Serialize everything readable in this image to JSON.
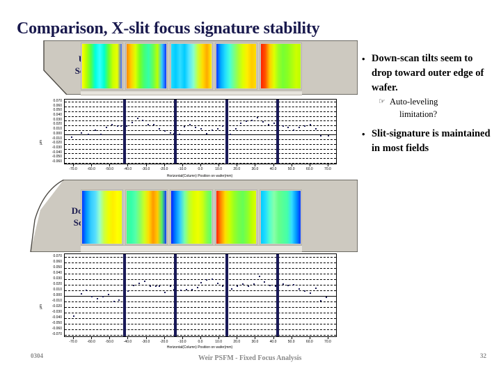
{
  "slide": {
    "title": "Comparison, X-slit focus signature stability",
    "title_color": "#19194d"
  },
  "wafer_up": {
    "label_line1": "Up",
    "label_line2": "Scan",
    "field_count": 5
  },
  "wafer_down": {
    "label_line1": "Down",
    "label_line2": "Scan",
    "field_count": 5
  },
  "bullets": {
    "item1": "Down-scan tilts seem to drop toward outer edge of wafer.",
    "sub1_icon": "pointing-hand-icon",
    "sub1_line1": "Auto-leveling",
    "sub1_line2": "limitation?",
    "item2": "Slit-signature is maintained in most fields",
    "bullet_glyph": "•"
  },
  "footer": {
    "date": "0304",
    "center": "Weir PSFM - Fixed Focus Analysis",
    "page": "32"
  },
  "chart_data": [
    {
      "id": "up-scan-chart",
      "type": "scatter",
      "title": "",
      "xlabel": "Horizontal(Column) Position on wafer(mm)",
      "ylabel": "µm",
      "xlim": [
        -75,
        75
      ],
      "ylim": [
        -0.065,
        0.075
      ],
      "grid": true,
      "legend": "none",
      "xticks": [
        -70.0,
        -60.0,
        -50.0,
        -40.0,
        -30.0,
        -20.0,
        -10.0,
        0.0,
        10.0,
        20.0,
        30.0,
        40.0,
        50.0,
        60.0,
        70.0
      ],
      "xtick_labels": [
        "-70.0",
        "-60.0",
        "-50.0",
        "-40.0",
        "-30.0",
        "-20.0",
        "-10.0",
        "0.0",
        "10.0",
        "20.0",
        "30.0",
        "40.0",
        "50.0",
        "60.0",
        "70.0"
      ],
      "yticks": [
        0.07,
        0.06,
        0.05,
        0.04,
        0.03,
        0.02,
        0.01,
        0.0,
        -0.01,
        -0.02,
        -0.03,
        -0.04,
        -0.05,
        -0.06
      ],
      "ytick_labels": [
        "0.070",
        "0.060",
        "0.050",
        "0.040",
        "0.030",
        "0.020",
        "0.010",
        "0.000",
        "-0.010",
        "-0.020",
        "-0.030",
        "-0.040",
        "-0.050",
        "-0.060"
      ],
      "field_boundaries": [
        -42.0,
        -14.0,
        14.0,
        42.0
      ],
      "x": [
        -71,
        -66,
        -62,
        -58,
        -55,
        -52,
        -49,
        -46,
        -44,
        -42,
        -41,
        -38,
        -35,
        -32,
        -29,
        -26,
        -23,
        -20,
        -17,
        -15,
        -14,
        -12,
        -9,
        -6,
        -3,
        0,
        3,
        6,
        9,
        12,
        14,
        16,
        19,
        22,
        25,
        28,
        31,
        34,
        37,
        40,
        42,
        45,
        48,
        51,
        54,
        57,
        60,
        63,
        66,
        70
      ],
      "y": [
        -0.006,
        0.004,
        0.0,
        0.009,
        0.0,
        0.016,
        0.021,
        0.019,
        0.018,
        -0.014,
        0.019,
        0.026,
        0.035,
        0.031,
        0.022,
        0.021,
        0.013,
        0.008,
        0.004,
        0.002,
        -0.005,
        0.001,
        0.017,
        0.021,
        0.016,
        0.013,
        0.002,
        0.009,
        0.013,
        0.018,
        -0.04,
        0.001,
        0.012,
        0.024,
        0.029,
        0.03,
        0.036,
        0.027,
        0.022,
        0.024,
        0.034,
        0.019,
        0.016,
        0.01,
        0.016,
        0.019,
        0.021,
        0.013,
        -0.003,
        -0.003
      ]
    },
    {
      "id": "down-scan-chart",
      "type": "scatter",
      "title": "",
      "xlabel": "Horizontal(Column) Position on wafer(mm)",
      "ylabel": "µm",
      "xlim": [
        -75,
        75
      ],
      "ylim": [
        -0.075,
        0.075
      ],
      "grid": true,
      "legend": "none",
      "xticks": [
        -70.0,
        -60.0,
        -50.0,
        -40.0,
        -30.0,
        -20.0,
        -10.0,
        0.0,
        10.0,
        20.0,
        30.0,
        40.0,
        50.0,
        60.0,
        70.0
      ],
      "xtick_labels": [
        "-70.0",
        "-60.0",
        "-50.0",
        "-40.0",
        "-30.0",
        "-20.0",
        "-10.0",
        "0.0",
        "10.0",
        "20.0",
        "30.0",
        "40.0",
        "50.0",
        "60.0",
        "70.0"
      ],
      "yticks": [
        0.07,
        0.06,
        0.05,
        0.04,
        0.03,
        0.02,
        0.01,
        0.0,
        -0.01,
        -0.02,
        -0.03,
        -0.04,
        -0.05,
        -0.06,
        -0.07
      ],
      "ytick_labels": [
        "0.070",
        "0.060",
        "0.050",
        "0.040",
        "0.030",
        "0.020",
        "0.010",
        "0.000",
        "-0.010",
        "-0.020",
        "-0.030",
        "-0.040",
        "-0.050",
        "-0.060",
        "-0.070"
      ],
      "field_boundaries": [
        -42.0,
        -14.0,
        14.0,
        42.0
      ],
      "x": [
        -70,
        -66,
        -63,
        -60,
        -57,
        -54,
        -51,
        -48,
        -45,
        -42,
        -40,
        -37,
        -34,
        -31,
        -28,
        -25,
        -23,
        -20,
        -17,
        -15,
        -14,
        -11,
        -8,
        -5,
        -2,
        0,
        3,
        6,
        9,
        12,
        14,
        17,
        20,
        23,
        26,
        29,
        32,
        35,
        38,
        41,
        42,
        45,
        48,
        51,
        54,
        57,
        60,
        63,
        66,
        69
      ],
      "y": [
        -0.036,
        0.004,
        0.01,
        -0.001,
        -0.005,
        -0.001,
        0.002,
        -0.01,
        -0.008,
        -0.041,
        0.009,
        0.019,
        0.022,
        0.026,
        0.017,
        0.017,
        0.017,
        0.006,
        0.018,
        0.011,
        -0.003,
        0.01,
        0.011,
        0.011,
        0.015,
        0.024,
        0.029,
        0.03,
        0.022,
        0.018,
        -0.048,
        0.012,
        0.017,
        0.021,
        0.017,
        0.021,
        0.035,
        0.025,
        0.019,
        0.018,
        0.032,
        0.021,
        0.019,
        0.02,
        0.013,
        0.009,
        0.005,
        0.014,
        -0.009,
        -0.003
      ]
    }
  ],
  "wafer_colormap": {
    "note": "rainbow vertical gradients per exposure field",
    "up_fields": [
      [
        "#ffff00",
        "#b4ff00",
        "#55ff44",
        "#00ffdd",
        "#33ffff",
        "#00ffd0",
        "#66ff33",
        "#ccff00",
        "#e8ff00",
        "#4466ff"
      ],
      [
        "#ff8800",
        "#ffcc00",
        "#ddff00",
        "#77ff22",
        "#44ff77",
        "#33ffaa",
        "#66ff55",
        "#bbff00",
        "#33ccff",
        "#1133ff"
      ],
      [
        "#22ddff",
        "#00ccff",
        "#33ddff",
        "#00ccff",
        "#55e5ff",
        "#88ffcc",
        "#ccff33",
        "#ffdd00",
        "#ffaa00",
        "#ffee00"
      ],
      [
        "#1133ff",
        "#00aaff",
        "#22ddff",
        "#44ffdd",
        "#77ff88",
        "#aaff33",
        "#ddff00",
        "#ffee00",
        "#ffcc00",
        "#ffdd00"
      ],
      [
        "#ff2200",
        "#ff5500",
        "#ffcc00",
        "#ddff00",
        "#99ff22",
        "#77ff33",
        "#88ff22",
        "#aaff11",
        "#ccff00",
        "#bbff00"
      ]
    ],
    "down_fields": [
      [
        "#0033ff",
        "#0099ff",
        "#33ccff",
        "#55ddff",
        "#99ffcc",
        "#ccff44",
        "#eeff00",
        "#ffee00",
        "#ffff00",
        "#eeff00"
      ],
      [
        "#44ff88",
        "#33ffaa",
        "#55ffaa",
        "#88ff66",
        "#ccff22",
        "#ffdd00",
        "#ff9900",
        "#ffcc00",
        "#55ee66",
        "#1133ff"
      ],
      [
        "#0022ff",
        "#0088ff",
        "#33ccff",
        "#77ffaa",
        "#bbff33",
        "#ddff00",
        "#eeff00",
        "#ccff11",
        "#88ff44",
        "#55ff77"
      ],
      [
        "#ff2200",
        "#ff8800",
        "#ffdd00",
        "#ccff00",
        "#99ff22",
        "#77ff44",
        "#66ff55",
        "#88ff33",
        "#bbff00",
        "#ddff00"
      ],
      [
        "#00ccff",
        "#22ddff",
        "#55ffcc",
        "#88ffaa",
        "#66ff88",
        "#55ff99",
        "#44ffaa",
        "#33ddff",
        "#0099ff",
        "#0033ff"
      ]
    ]
  }
}
